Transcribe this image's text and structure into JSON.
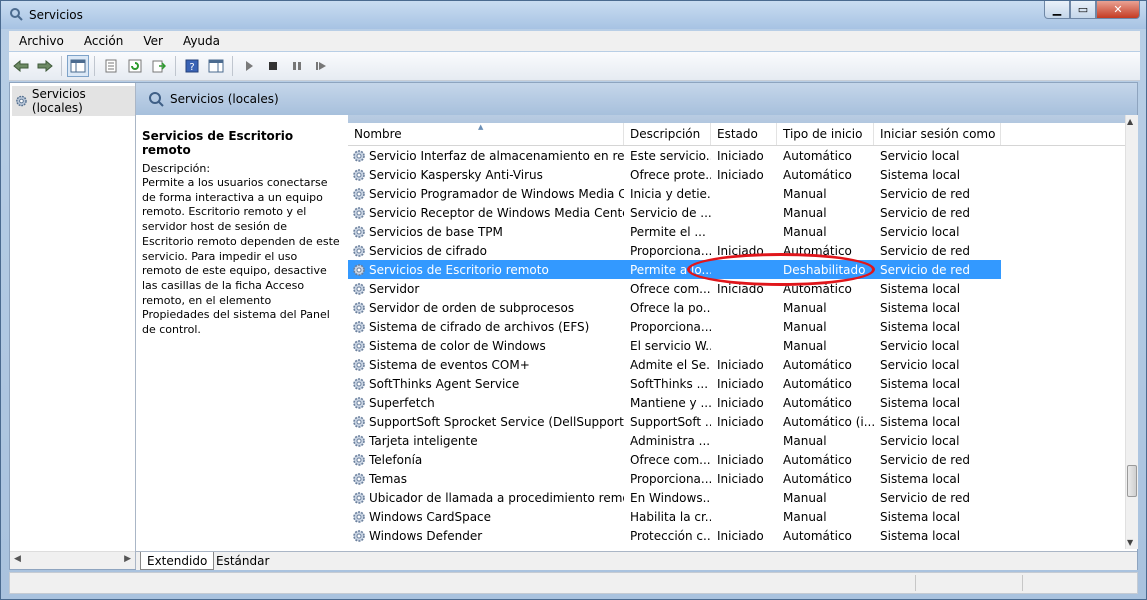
{
  "window": {
    "title": "Servicios"
  },
  "menu": [
    "Archivo",
    "Acción",
    "Ver",
    "Ayuda"
  ],
  "tree": {
    "root": "Servicios (locales)"
  },
  "pane": {
    "header": "Servicios (locales)"
  },
  "description": {
    "service_name": "Servicios de Escritorio remoto",
    "label": "Descripción:",
    "text": "Permite a los usuarios conectarse de forma interactiva a un equipo remoto. Escritorio remoto y el servidor host de sesión de Escritorio remoto dependen de este servicio. Para impedir el uso remoto de este equipo, desactive las casillas de la ficha Acceso remoto, en el elemento Propiedades del sistema del Panel de control."
  },
  "columns": [
    "Nombre",
    "Descripción",
    "Estado",
    "Tipo de inicio",
    "Iniciar sesión como"
  ],
  "rows": [
    {
      "name": "Servicio Interfaz de almacenamiento en red",
      "desc": "Este servicio...",
      "state": "Iniciado",
      "type": "Automático",
      "login": "Servicio local"
    },
    {
      "name": "Servicio Kaspersky Anti-Virus",
      "desc": "Ofrece prote...",
      "state": "Iniciado",
      "type": "Automático",
      "login": "Sistema local"
    },
    {
      "name": "Servicio Programador de Windows Media Cen...",
      "desc": "Inicia y detie...",
      "state": "",
      "type": "Manual",
      "login": "Servicio de red"
    },
    {
      "name": "Servicio Receptor de Windows Media Center",
      "desc": "Servicio de ...",
      "state": "",
      "type": "Manual",
      "login": "Servicio de red"
    },
    {
      "name": "Servicios de base TPM",
      "desc": "Permite el ...",
      "state": "",
      "type": "Manual",
      "login": "Servicio local"
    },
    {
      "name": "Servicios de cifrado",
      "desc": "Proporciona...",
      "state": "Iniciado",
      "type": "Automático",
      "login": "Servicio de red"
    },
    {
      "name": "Servicios de Escritorio remoto",
      "desc": "Permite a lo...",
      "state": "",
      "type": "Deshabilitado",
      "login": "Servicio de red",
      "selected": true
    },
    {
      "name": "Servidor",
      "desc": "Ofrece com...",
      "state": "Iniciado",
      "type": "Automático",
      "login": "Sistema local"
    },
    {
      "name": "Servidor de orden de subprocesos",
      "desc": "Ofrece la po...",
      "state": "",
      "type": "Manual",
      "login": "Sistema local"
    },
    {
      "name": "Sistema de cifrado de archivos (EFS)",
      "desc": "Proporciona...",
      "state": "",
      "type": "Manual",
      "login": "Sistema local"
    },
    {
      "name": "Sistema de color de Windows",
      "desc": "El servicio W...",
      "state": "",
      "type": "Manual",
      "login": "Servicio local"
    },
    {
      "name": "Sistema de eventos COM+",
      "desc": "Admite el Se...",
      "state": "Iniciado",
      "type": "Automático",
      "login": "Servicio local"
    },
    {
      "name": "SoftThinks Agent Service",
      "desc": "SoftThinks ...",
      "state": "Iniciado",
      "type": "Automático",
      "login": "Sistema local"
    },
    {
      "name": "Superfetch",
      "desc": "Mantiene y ...",
      "state": "Iniciado",
      "type": "Automático",
      "login": "Sistema local"
    },
    {
      "name": "SupportSoft Sprocket Service (DellSupportCen...",
      "desc": "SupportSoft ...",
      "state": "Iniciado",
      "type": "Automático (i...",
      "login": "Sistema local"
    },
    {
      "name": "Tarjeta inteligente",
      "desc": "Administra ...",
      "state": "",
      "type": "Manual",
      "login": "Servicio local"
    },
    {
      "name": "Telefonía",
      "desc": "Ofrece com...",
      "state": "Iniciado",
      "type": "Automático",
      "login": "Servicio de red"
    },
    {
      "name": "Temas",
      "desc": "Proporciona...",
      "state": "Iniciado",
      "type": "Automático",
      "login": "Sistema local"
    },
    {
      "name": "Ubicador de llamada a procedimiento remoto...",
      "desc": "En Windows...",
      "state": "",
      "type": "Manual",
      "login": "Servicio de red"
    },
    {
      "name": "Windows CardSpace",
      "desc": "Habilita la cr...",
      "state": "",
      "type": "Manual",
      "login": "Sistema local"
    },
    {
      "name": "Windows Defender",
      "desc": "Protección c...",
      "state": "Iniciado",
      "type": "Automático",
      "login": "Sistema local"
    }
  ],
  "tabs": [
    "Extendido",
    "Estándar"
  ],
  "colors": {
    "selection": "#3399ff",
    "annotation": "#e0161b"
  }
}
